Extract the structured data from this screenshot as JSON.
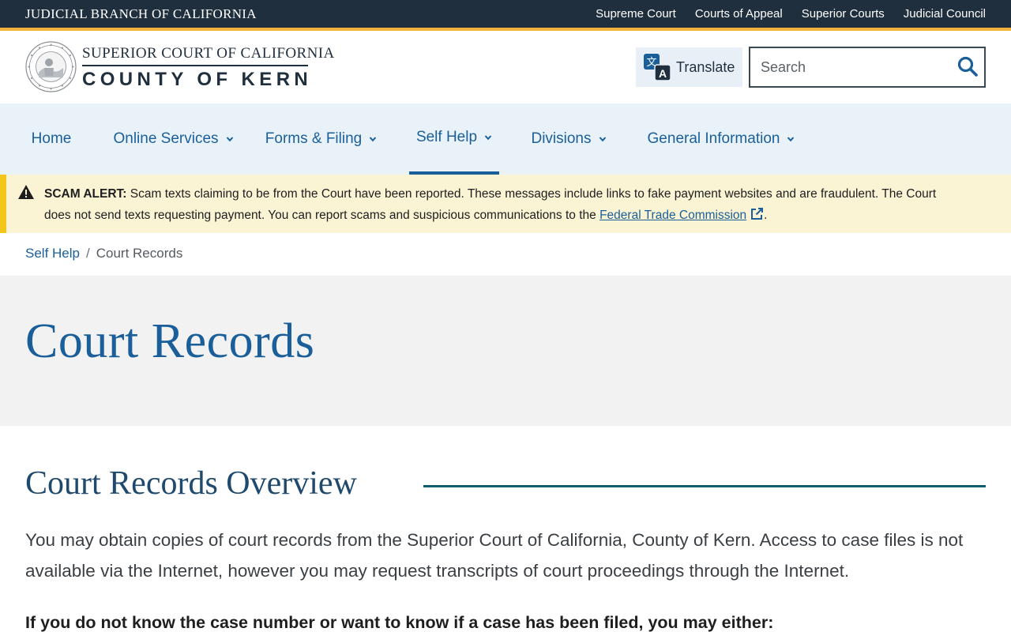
{
  "utility_bar": {
    "brand": "JUDICIAL BRANCH OF CALIFORNIA",
    "links": [
      "Supreme Court",
      "Courts of Appeal",
      "Superior Courts",
      "Judicial Council"
    ]
  },
  "header": {
    "logo_line1": "SUPERIOR COURT OF CALIFORNIA",
    "logo_line2": "COUNTY OF KERN",
    "seal_icon": "california-judicial-seal-icon",
    "translate_label": "Translate",
    "search_placeholder": "Search"
  },
  "nav": {
    "items": [
      {
        "label": "Home",
        "has_menu": false,
        "active": false
      },
      {
        "label": "Online Services",
        "has_menu": true,
        "active": false
      },
      {
        "label": "Forms & Filing",
        "has_menu": true,
        "active": false
      },
      {
        "label": "Self Help",
        "has_menu": true,
        "active": true
      },
      {
        "label": "Divisions",
        "has_menu": true,
        "active": false
      },
      {
        "label": "General Information",
        "has_menu": true,
        "active": false
      }
    ]
  },
  "alert": {
    "label": "SCAM ALERT:",
    "text": " Scam texts claiming to be from the Court have been reported. These messages include links to fake payment websites and are fraudulent. The Court does not send texts requesting payment. You can report scams and suspicious communications to the ",
    "link_text": "Federal Trade Commission",
    "after_link": "."
  },
  "breadcrumb": {
    "parent": "Self Help",
    "separator": "/",
    "current": "Court Records"
  },
  "hero": {
    "title": "Court Records"
  },
  "content": {
    "section_title": "Court Records Overview",
    "intro": "You may obtain copies of court records from the Superior Court of California, County of Kern. Access to case files is not available via the Internet, however you may request transcripts of court proceedings through the Internet.",
    "lead_question": "If you do not know the case number or want to know if a case has been filed, you may either:"
  },
  "colors": {
    "utility_bg": "#1f2f3e",
    "gold": "#f2b33d",
    "accent_blue": "#1a5f9a",
    "nav_bg": "#eaf2f9",
    "alert_bg": "#faf3d4",
    "alert_border": "#f4c51b",
    "hero_bg": "#f2f2f2"
  }
}
